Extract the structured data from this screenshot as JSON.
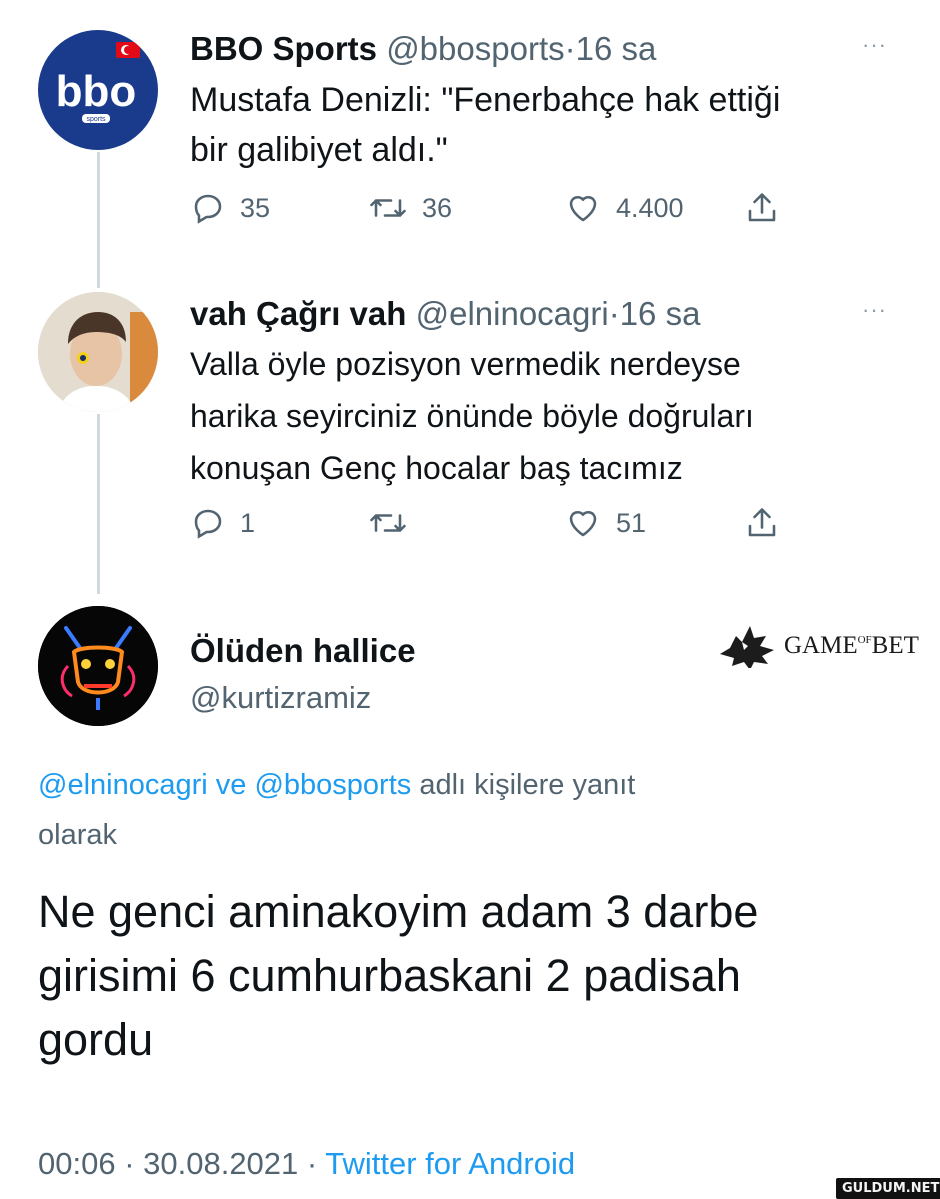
{
  "tweet1": {
    "display_name": "BBO Sports",
    "handle": "@bbosports",
    "dot": "·",
    "time": "16 sa",
    "more": "···",
    "text_line1": "Mustafa Denizli: \"Fenerbahçe hak ettiği",
    "text_line2": "bir galibiyet aldı.\"",
    "avatar_text": "bbo",
    "avatar_sub": "sports",
    "replies": "35",
    "retweets": "36",
    "likes": "4.400"
  },
  "tweet2": {
    "display_name": "vah Çağrı vah",
    "handle": "@elninocagri",
    "dot": "·",
    "time": "16 sa",
    "more": "···",
    "text_line1": "Valla öyle pozisyon vermedik nerdeyse",
    "text_line2": "harika seyirciniz önünde böyle doğruları",
    "text_line3": "konuşan Genç hocalar baş tacımız",
    "replies": "1",
    "likes": "51"
  },
  "tweet3": {
    "display_name": "Ölüden hallice",
    "handle": "@kurtizramiz",
    "reply_mention1": "@elninocagri",
    "reply_ve": "ve",
    "reply_mention2": "@bbosports",
    "reply_suffix": "adlı kişilere yanıt",
    "reply_suffix2": "olarak",
    "text_line1": "Ne genci aminakoyim adam 3 darbe",
    "text_line2": "girisimi 6 cumhurbaskani 2 padisah",
    "text_line3": "gordu",
    "timestamp": "00:06 · 30.08.2021 ·",
    "source": "Twitter for Android"
  },
  "watermark_gameofbet": {
    "game": "GAME",
    "of": "OF",
    "bet": "BET"
  },
  "watermark_guldum": "GULDUM.NET",
  "colors": {
    "accent": "#1d9bf0",
    "muted": "#536471",
    "bbo_blue": "#1a3b8c"
  },
  "icons": [
    "reply-icon",
    "retweet-icon",
    "like-icon",
    "share-icon",
    "more-icon",
    "wolf-icon"
  ]
}
